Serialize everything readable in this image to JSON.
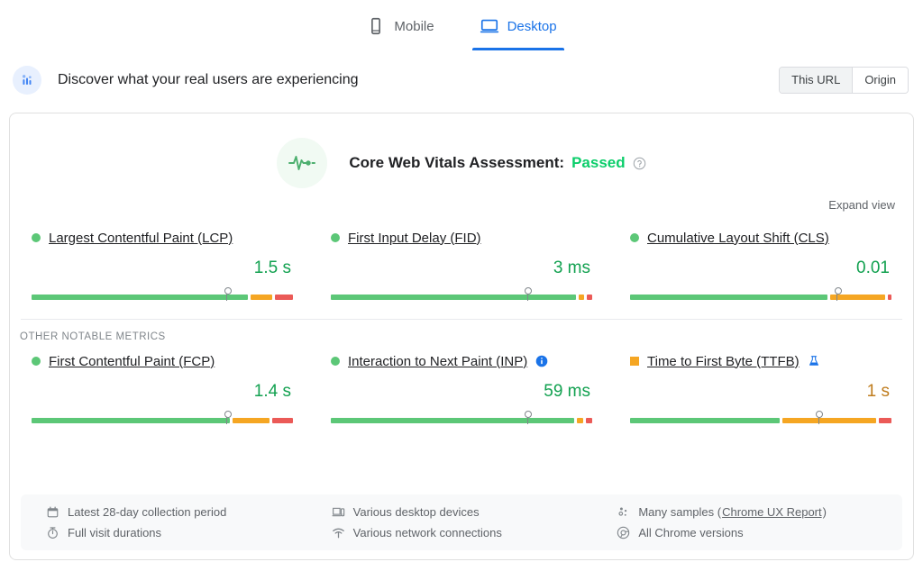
{
  "tabs": [
    {
      "label": "Mobile",
      "icon": "mobile-icon",
      "active": false
    },
    {
      "label": "Desktop",
      "icon": "desktop-icon",
      "active": true
    }
  ],
  "discover": {
    "title": "Discover what your real users are experiencing",
    "icon": "field-data-icon",
    "scope_options": [
      {
        "label": "This URL",
        "selected": true
      },
      {
        "label": "Origin",
        "selected": false
      }
    ]
  },
  "assessment": {
    "icon": "pulse-icon",
    "label": "Core Web Vitals Assessment:",
    "result": "Passed",
    "help_icon": "help-icon"
  },
  "expand_view": "Expand view",
  "other_metrics_label": "OTHER NOTABLE METRICS",
  "colors": {
    "good": "#5cc777",
    "needs_improvement": "#f5a623",
    "poor": "#eb5a57",
    "pass_text": "#0cce6b",
    "value_good": "#12a150",
    "value_ni": "#bf7c1d",
    "accent": "#1a73e8"
  },
  "core_metrics": [
    {
      "name": "Largest Contentful Paint (LCP)",
      "value": "1.5 s",
      "status": "good",
      "indicator": "dot",
      "marker_pct": 74.5,
      "bar": [
        {
          "color": "good",
          "pct": 82.0
        },
        {
          "color": "needs_improvement",
          "pct": 8.0
        },
        {
          "color": "poor",
          "pct": 7.0
        }
      ]
    },
    {
      "name": "First Input Delay (FID)",
      "value": "3 ms",
      "status": "good",
      "indicator": "dot",
      "marker_pct": 75.0,
      "bar": [
        {
          "color": "good",
          "pct": 94.0
        },
        {
          "color": "needs_improvement",
          "pct": 2.0
        },
        {
          "color": "poor",
          "pct": 2.0
        }
      ]
    },
    {
      "name": "Cumulative Layout Shift (CLS)",
      "value": "0.01",
      "status": "good",
      "indicator": "dot",
      "marker_pct": 79.0,
      "bar": [
        {
          "color": "good",
          "pct": 76.0
        },
        {
          "color": "needs_improvement",
          "pct": 21.0
        },
        {
          "color": "poor",
          "pct": 1.5
        }
      ]
    }
  ],
  "other_notable_metrics": [
    {
      "name": "First Contentful Paint (FCP)",
      "value": "1.4 s",
      "status": "good",
      "indicator": "dot",
      "badge_icon": null,
      "marker_pct": 74.5,
      "bar": [
        {
          "color": "good",
          "pct": 76.0
        },
        {
          "color": "needs_improvement",
          "pct": 14.0
        },
        {
          "color": "poor",
          "pct": 8.0
        }
      ]
    },
    {
      "name": "Interaction to Next Paint (INP)",
      "value": "59 ms",
      "status": "good",
      "indicator": "dot",
      "badge_icon": "info-icon",
      "marker_pct": 75.0,
      "bar": [
        {
          "color": "good",
          "pct": 93.0
        },
        {
          "color": "needs_improvement",
          "pct": 2.5
        },
        {
          "color": "poor",
          "pct": 2.5
        }
      ]
    },
    {
      "name": "Time to First Byte (TTFB)",
      "value": "1 s",
      "status": "needs_improvement",
      "indicator": "square",
      "badge_icon": "flask-icon",
      "marker_pct": 72.0,
      "bar": [
        {
          "color": "good",
          "pct": 58.0
        },
        {
          "color": "needs_improvement",
          "pct": 36.0
        },
        {
          "color": "poor",
          "pct": 5.0
        }
      ]
    }
  ],
  "footer": [
    {
      "icon": "calendar-icon",
      "text": "Latest 28-day collection period",
      "link": null
    },
    {
      "icon": "monitor-icon",
      "text": "Various desktop devices",
      "link": null
    },
    {
      "icon": "samples-icon",
      "text": "Many samples (",
      "link": "Chrome UX Report",
      "text_after": ")"
    },
    {
      "icon": "stopwatch-icon",
      "text": "Full visit durations",
      "link": null
    },
    {
      "icon": "wifi-icon",
      "text": "Various network connections",
      "link": null
    },
    {
      "icon": "chrome-icon",
      "text": "All Chrome versions",
      "link": null
    }
  ]
}
